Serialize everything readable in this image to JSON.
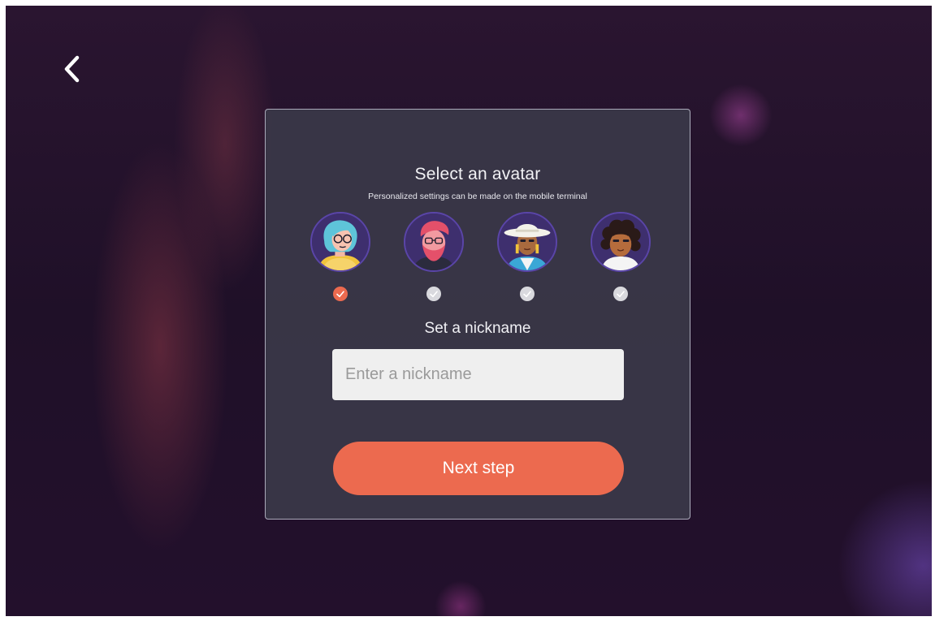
{
  "back": {
    "icon": "chevron-left-icon"
  },
  "card": {
    "title": "Select an avatar",
    "subtitle": "Personalized settings can be made on the mobile terminal"
  },
  "avatars": [
    {
      "name": "avatar-blue-hair-glasses",
      "selected": true
    },
    {
      "name": "avatar-pink-hair-beard",
      "selected": false
    },
    {
      "name": "avatar-white-hat",
      "selected": false
    },
    {
      "name": "avatar-curly-hair",
      "selected": false
    }
  ],
  "nickname": {
    "label": "Set a nickname",
    "value": "",
    "placeholder": "Enter a nickname"
  },
  "next_button": {
    "label": "Next step"
  },
  "colors": {
    "accent": "#ec6a4f",
    "card": "#3a3848",
    "avatar_ring": "#5a45a8",
    "unselected_check": "#d9d9de"
  }
}
